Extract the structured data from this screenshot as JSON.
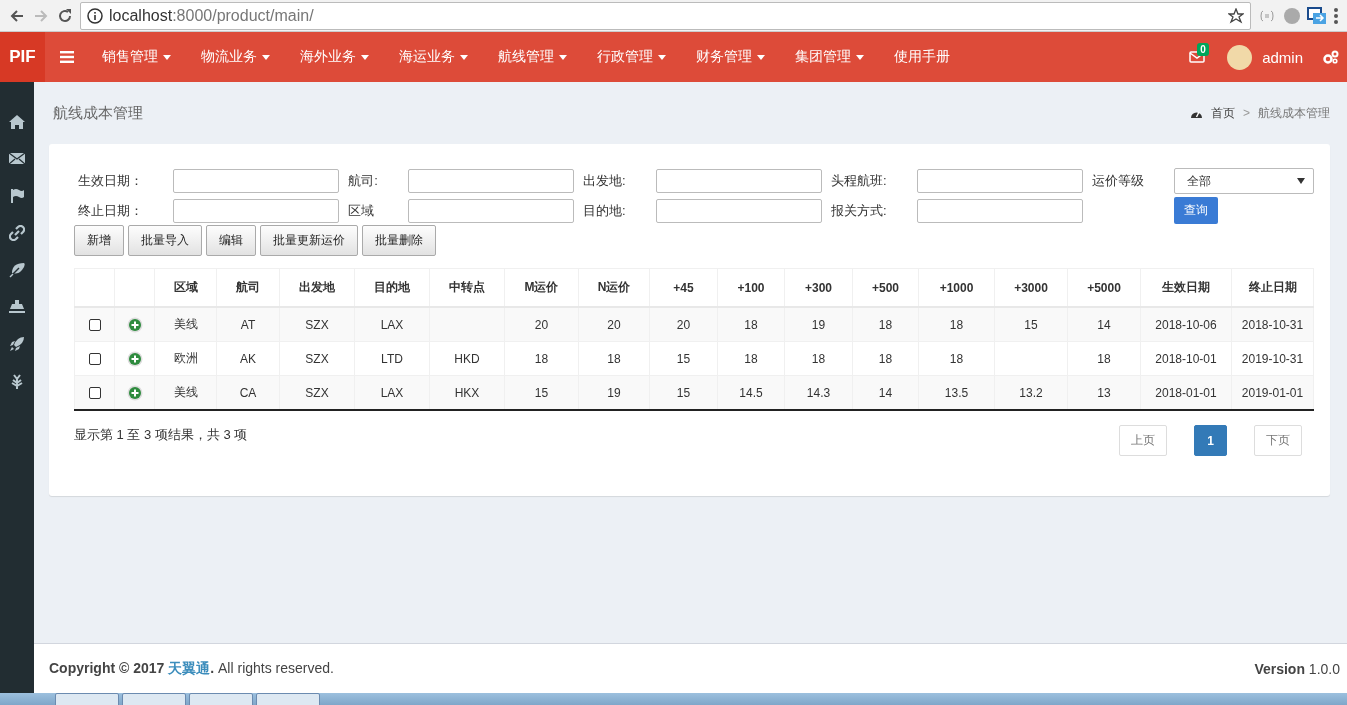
{
  "browser": {
    "url_host": "localhost",
    "url_rest": ":8000/product/main/"
  },
  "topbar": {
    "logo": "PIF",
    "nav": [
      {
        "label": "销售管理",
        "has_caret": true
      },
      {
        "label": "物流业务",
        "has_caret": true
      },
      {
        "label": "海外业务",
        "has_caret": true
      },
      {
        "label": "海运业务",
        "has_caret": true
      },
      {
        "label": "航线管理",
        "has_caret": true
      },
      {
        "label": "行政管理",
        "has_caret": true
      },
      {
        "label": "财务管理",
        "has_caret": true
      },
      {
        "label": "集团管理",
        "has_caret": true
      },
      {
        "label": "使用手册",
        "has_caret": false
      }
    ],
    "mail_badge": "0",
    "user": "admin"
  },
  "page": {
    "title": "航线成本管理",
    "breadcrumb": [
      {
        "label": "首页"
      },
      {
        "label": "航线成本管理"
      }
    ],
    "breadcrumb_separator": ">"
  },
  "filters": [
    {
      "kind": "text",
      "label": "生效日期："
    },
    {
      "kind": "text",
      "label": "航司:"
    },
    {
      "kind": "text",
      "label": "出发地:"
    },
    {
      "kind": "text",
      "label": "头程航班:"
    },
    {
      "kind": "select",
      "label": "运价等级",
      "value": "全部"
    },
    {
      "kind": "text",
      "label": "终止日期："
    },
    {
      "kind": "text",
      "label": "区域"
    },
    {
      "kind": "text",
      "label": "目的地:"
    },
    {
      "kind": "text",
      "label": "报关方式:"
    },
    {
      "kind": "button",
      "label": "查询"
    }
  ],
  "actions": [
    "新增",
    "批量导入",
    "编辑",
    "批量更新运价",
    "批量删除"
  ],
  "table": {
    "columns": [
      "",
      "",
      "区域",
      "航司",
      "出发地",
      "目的地",
      "中转点",
      "M运价",
      "N运价",
      "+45",
      "+100",
      "+300",
      "+500",
      "+1000",
      "+3000",
      "+5000",
      "生效日期",
      "终止日期"
    ],
    "rows": [
      {
        "checked": false,
        "cells": [
          "",
          "",
          "美线",
          "AT",
          "SZX",
          "LAX",
          "",
          "20",
          "20",
          "20",
          "18",
          "19",
          "18",
          "18",
          "15",
          "14",
          "2018-10-06",
          "2018-10-31"
        ]
      },
      {
        "checked": false,
        "cells": [
          "",
          "",
          "欧洲",
          "AK",
          "SZX",
          "LTD",
          "HKD",
          "18",
          "18",
          "15",
          "18",
          "18",
          "18",
          "18",
          "",
          "18",
          "2018-10-01",
          "2019-10-31"
        ]
      },
      {
        "checked": false,
        "cells": [
          "",
          "",
          "美线",
          "CA",
          "SZX",
          "LAX",
          "HKX",
          "15",
          "19",
          "15",
          "14.5",
          "14.3",
          "14",
          "13.5",
          "13.2",
          "13",
          "2018-01-01",
          "2019-01-01"
        ]
      }
    ]
  },
  "summary": "显示第 1 至 3 项结果，共 3 项",
  "pagination": {
    "prev": "上页",
    "pages": [
      {
        "label": "1",
        "selected": true
      }
    ],
    "next": "下页"
  },
  "footer": {
    "copyright_prefix": "**Copyright © 2017**",
    "company": "天翼通",
    "copyright_suffix": "**.** All rights reserved.",
    "version": "**Version** 1.0.0"
  }
}
